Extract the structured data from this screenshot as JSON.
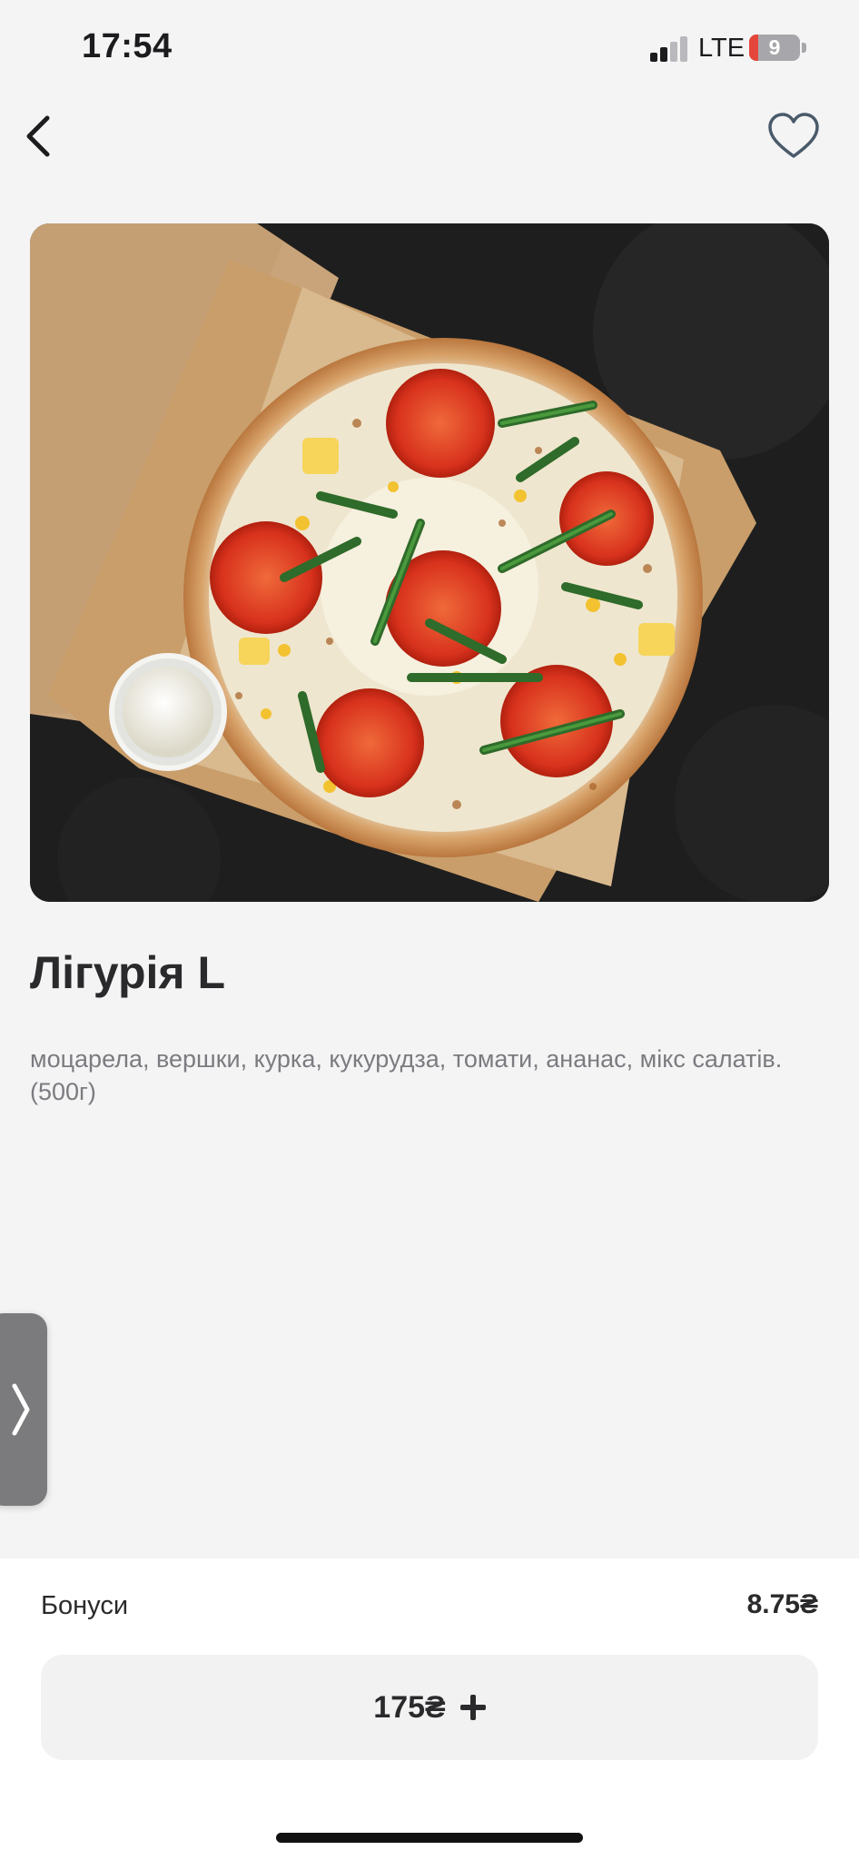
{
  "status_bar": {
    "time": "17:54",
    "network": "LTE",
    "battery_level": "9",
    "battery_fraction": 0.09
  },
  "nav": {
    "back_icon": "chevron-left-icon",
    "favorite_icon": "heart-outline-icon"
  },
  "product": {
    "image_icon": "pizza-photo",
    "name": "Лігурія L",
    "description": "моцарела, вершки, курка, кукурудза, томати, ананас, мікс салатів.(500г)"
  },
  "drawer": {
    "icon": "chevron-right-icon"
  },
  "footer": {
    "bonus_label": "Бонуси",
    "bonus_value": "8.75₴",
    "price": "175₴",
    "add_icon": "plus-icon"
  },
  "colors": {
    "background": "#f4f4f5",
    "text": "#2a2a2c",
    "muted_text": "#7b7b80",
    "battery_low": "#e5463c"
  }
}
